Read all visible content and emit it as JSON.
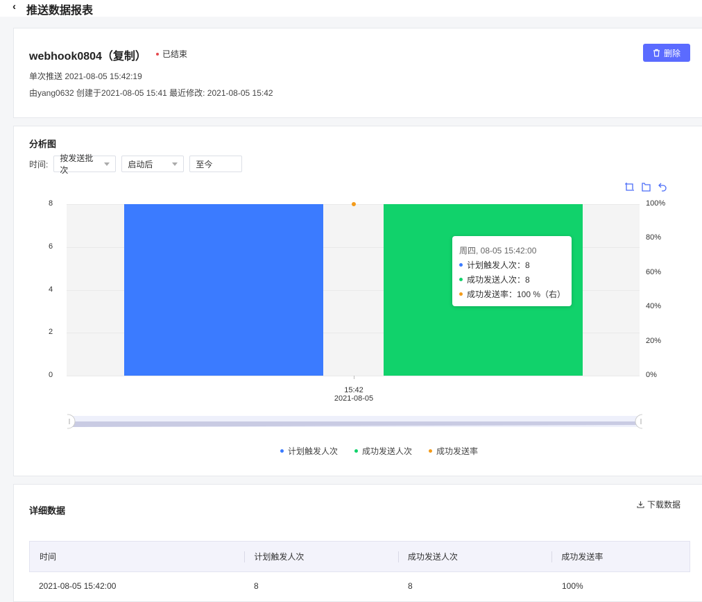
{
  "header": {
    "title": "推送数据报表"
  },
  "summary": {
    "name": "webhook0804（复制）",
    "status": "已结束",
    "delete_label": "删除",
    "push_info": "单次推送  2021-08-05 15:42:19",
    "created_info": "由yang0632 创建于2021-08-05 15:41 最近修改: 2021-08-05 15:42"
  },
  "analysis": {
    "title": "分析图",
    "filter_label": "时间:",
    "filter_mode": "按发送批次",
    "filter_start": "启动后",
    "filter_end": "至今",
    "tools": [
      "zoom-select-icon",
      "zoom-reset-icon",
      "undo-icon"
    ]
  },
  "colors": {
    "planned": "#3b7bff",
    "success": "#11d26b",
    "rate": "#f39b1a",
    "accent": "#5b6bff"
  },
  "chart_data": {
    "type": "bar",
    "categories": [
      "15:42\n2021-08-05"
    ],
    "x_tick_time": "15:42",
    "x_tick_date": "2021-08-05",
    "series": [
      {
        "name": "计划触发人次",
        "type": "bar",
        "values": [
          8
        ],
        "axis": "left"
      },
      {
        "name": "成功发送人次",
        "type": "bar",
        "values": [
          8
        ],
        "axis": "left"
      },
      {
        "name": "成功发送率",
        "type": "line",
        "values": [
          100
        ],
        "axis": "right"
      }
    ],
    "yaxis_left": {
      "ticks": [
        "8",
        "6",
        "4",
        "2",
        "0"
      ],
      "range": [
        0,
        8
      ]
    },
    "yaxis_right": {
      "ticks": [
        "100%",
        "80%",
        "60%",
        "40%",
        "20%",
        "0%"
      ],
      "range": [
        0,
        100
      ]
    },
    "legend_position": "bottom",
    "tooltip": {
      "title": "周四, 08-05 15:42:00",
      "rows": [
        "计划触发人次：8",
        "成功发送人次：8",
        "成功发送率：100 %（右）"
      ]
    }
  },
  "detail": {
    "title": "详细数据",
    "download_label": "下载数据",
    "columns": [
      "时间",
      "计划触发人次",
      "成功发送人次",
      "成功发送率"
    ],
    "rows": [
      [
        "2021-08-05 15:42:00",
        "8",
        "8",
        "100%"
      ]
    ]
  }
}
